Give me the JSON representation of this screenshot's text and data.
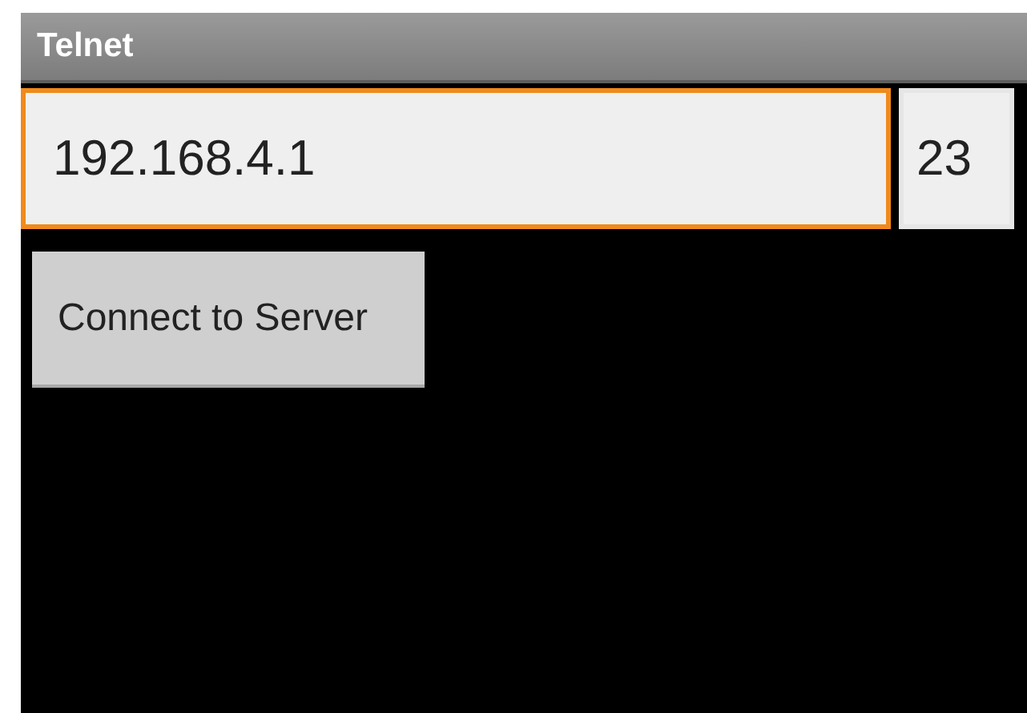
{
  "window": {
    "title": "Telnet"
  },
  "host_field": {
    "value": "192.168.4.1",
    "focused": true
  },
  "port_field": {
    "value": "23",
    "focused": false
  },
  "buttons": [
    "Connect to Server"
  ]
}
